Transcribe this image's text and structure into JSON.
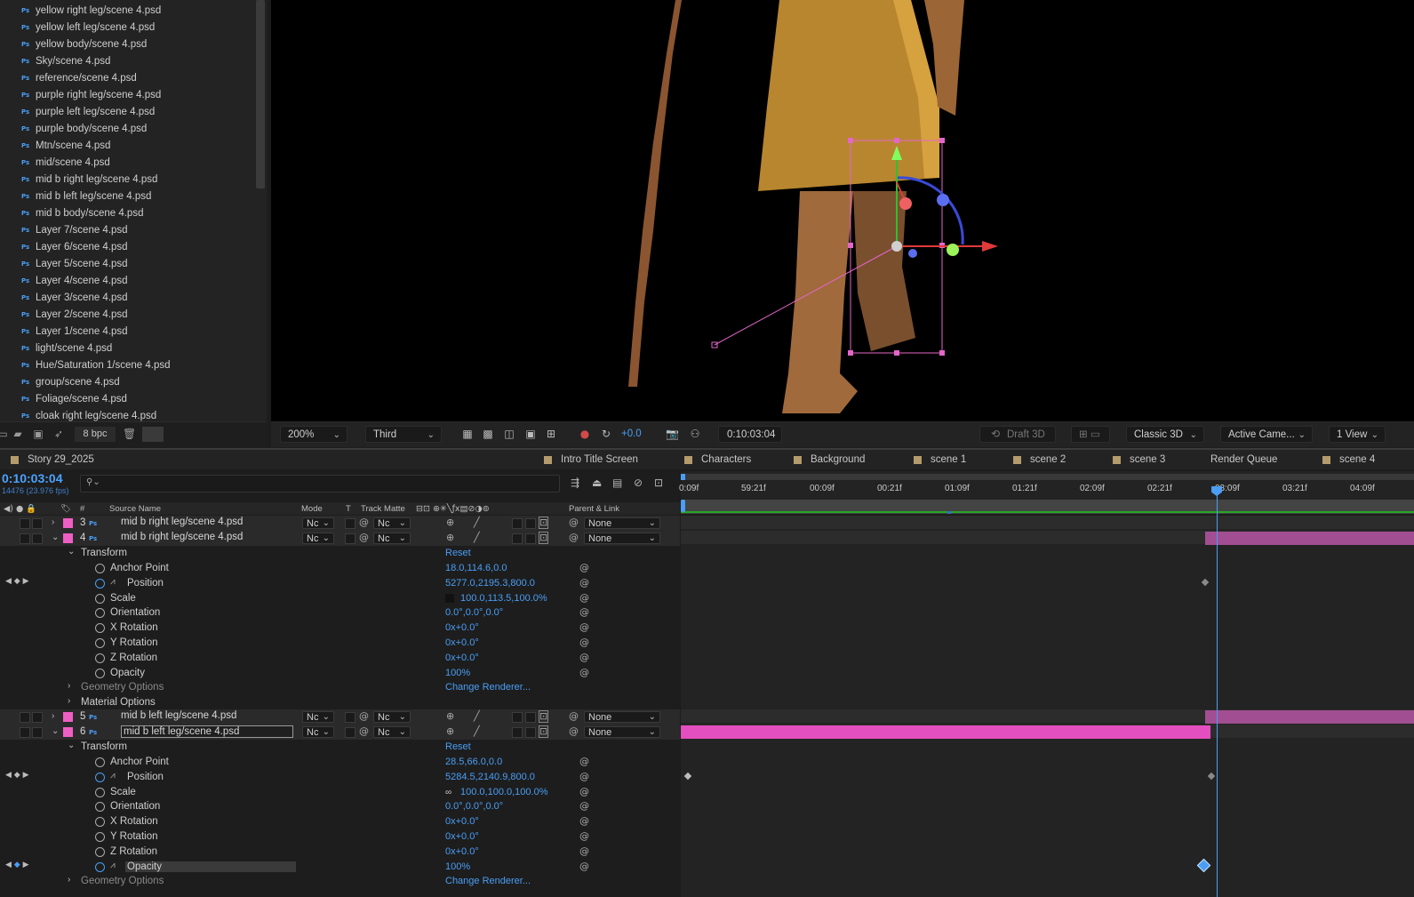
{
  "project": {
    "items": [
      "yellow right leg/scene 4.psd",
      "yellow left leg/scene 4.psd",
      "yellow body/scene 4.psd",
      "Sky/scene 4.psd",
      "reference/scene 4.psd",
      "purple right leg/scene 4.psd",
      "purple left leg/scene 4.psd",
      "purple body/scene 4.psd",
      "Mtn/scene 4.psd",
      "mid/scene 4.psd",
      "mid b right leg/scene 4.psd",
      "mid b left leg/scene 4.psd",
      "mid b body/scene 4.psd",
      "Layer 7/scene 4.psd",
      "Layer 6/scene 4.psd",
      "Layer 5/scene 4.psd",
      "Layer 4/scene 4.psd",
      "Layer 3/scene 4.psd",
      "Layer 2/scene 4.psd",
      "Layer 1/scene 4.psd",
      "light/scene 4.psd",
      "Hue/Saturation 1/scene 4.psd",
      "group/scene 4.psd",
      "Foliage/scene 4.psd",
      "cloak right leg/scene 4.psd"
    ],
    "file_icon": "Ps",
    "bpc_label": "8 bpc"
  },
  "viewer": {
    "zoom": "200%",
    "view_mode": "Third",
    "exposure": "+0.0",
    "timecode": "0:10:03:04",
    "draft3d": "Draft 3D",
    "renderer": "Classic 3D",
    "camera": "Active Came...",
    "views": "1 View"
  },
  "tabs": [
    {
      "label": "Story 29_2025",
      "color": "#b49b6c"
    },
    {
      "label": "Intro Title Screen",
      "color": "#b49b6c"
    },
    {
      "label": "Characters",
      "color": "#b49b6c"
    },
    {
      "label": "Background",
      "color": "#b49b6c"
    },
    {
      "label": "scene 1",
      "color": "#b49b6c"
    },
    {
      "label": "scene 2",
      "color": "#b49b6c"
    },
    {
      "label": "scene 3",
      "color": "#b49b6c"
    },
    {
      "label": "Render Queue",
      "color": ""
    },
    {
      "label": "scene 4",
      "color": "#b49b6c"
    }
  ],
  "timeline": {
    "current_time": "0:10:03:04",
    "fps": "14476 (23.976 fps)",
    "columns": {
      "num": "#",
      "source": "Source Name",
      "mode": "Mode",
      "t": "T",
      "track_matte": "Track Matte",
      "parent": "Parent & Link"
    },
    "ruler": [
      "0:09f",
      "59:21f",
      "00:09f",
      "00:21f",
      "01:09f",
      "01:21f",
      "02:09f",
      "02:21f",
      "03:09f",
      "03:21f",
      "04:09f"
    ],
    "layers": [
      {
        "num": "3",
        "name": "mid b right leg/scene 4.psd",
        "mode": "Nc",
        "matte": "Nc",
        "parent": "None"
      },
      {
        "num": "4",
        "name": "mid b right leg/scene 4.psd",
        "mode": "Nc",
        "matte": "Nc",
        "parent": "None"
      },
      {
        "num": "5",
        "name": "mid b left leg/scene 4.psd",
        "mode": "Nc",
        "matte": "Nc",
        "parent": "None"
      },
      {
        "num": "6",
        "name": "mid b left leg/scene 4.psd",
        "mode": "Nc",
        "matte": "Nc",
        "parent": "None"
      }
    ],
    "transform_label": "Transform",
    "reset_label": "Reset",
    "geometry_label": "Geometry Options",
    "material_label": "Material Options",
    "change_renderer": "Change Renderer...",
    "props4": [
      {
        "label": "Anchor Point",
        "value": "18.0,114.6,0.0"
      },
      {
        "label": "Position",
        "value": "5277.0,2195.3,800.0"
      },
      {
        "label": "Scale",
        "value": "100.0,113.5,100.0%"
      },
      {
        "label": "Orientation",
        "value": "0.0°,0.0°,0.0°"
      },
      {
        "label": "X Rotation",
        "value": "0x+0.0°"
      },
      {
        "label": "Y Rotation",
        "value": "0x+0.0°"
      },
      {
        "label": "Z Rotation",
        "value": "0x+0.0°"
      },
      {
        "label": "Opacity",
        "value": "100%"
      }
    ],
    "props6": [
      {
        "label": "Anchor Point",
        "value": "28.5,66.0,0.0"
      },
      {
        "label": "Position",
        "value": "5284.5,2140.9,800.0"
      },
      {
        "label": "Scale",
        "value": "100.0,100.0,100.0%"
      },
      {
        "label": "Orientation",
        "value": "0.0°,0.0°,0.0°"
      },
      {
        "label": "X Rotation",
        "value": "0x+0.0°"
      },
      {
        "label": "Y Rotation",
        "value": "0x+0.0°"
      },
      {
        "label": "Z Rotation",
        "value": "0x+0.0°"
      },
      {
        "label": "Opacity",
        "value": "100%"
      }
    ],
    "label_color": "#ef5fc3",
    "accent": "#4a9ef5"
  }
}
